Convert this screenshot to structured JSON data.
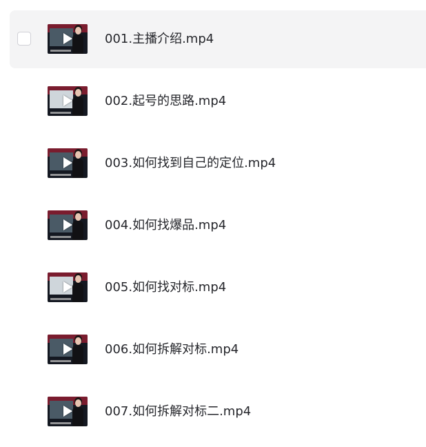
{
  "files": [
    {
      "name": "001.主播介绍.mp4",
      "selected": false
    },
    {
      "name": "002.起号的思路.mp4",
      "selected": false
    },
    {
      "name": "003.如何找到自己的定位.mp4",
      "selected": false
    },
    {
      "name": "004.如何找爆品.mp4",
      "selected": false
    },
    {
      "name": "005.如何找对标.mp4",
      "selected": false
    },
    {
      "name": "006.如何拆解对标.mp4",
      "selected": false
    },
    {
      "name": "007.如何拆解对标二.mp4",
      "selected": false
    }
  ],
  "icons": {
    "thumbnail": "video-thumbnail-icon",
    "play": "play-icon",
    "checkbox": "checkbox-icon"
  },
  "colors": {
    "hover_row": "#f4f4f5",
    "text": "#25262b",
    "thumb_band": "#7a1c2e"
  }
}
